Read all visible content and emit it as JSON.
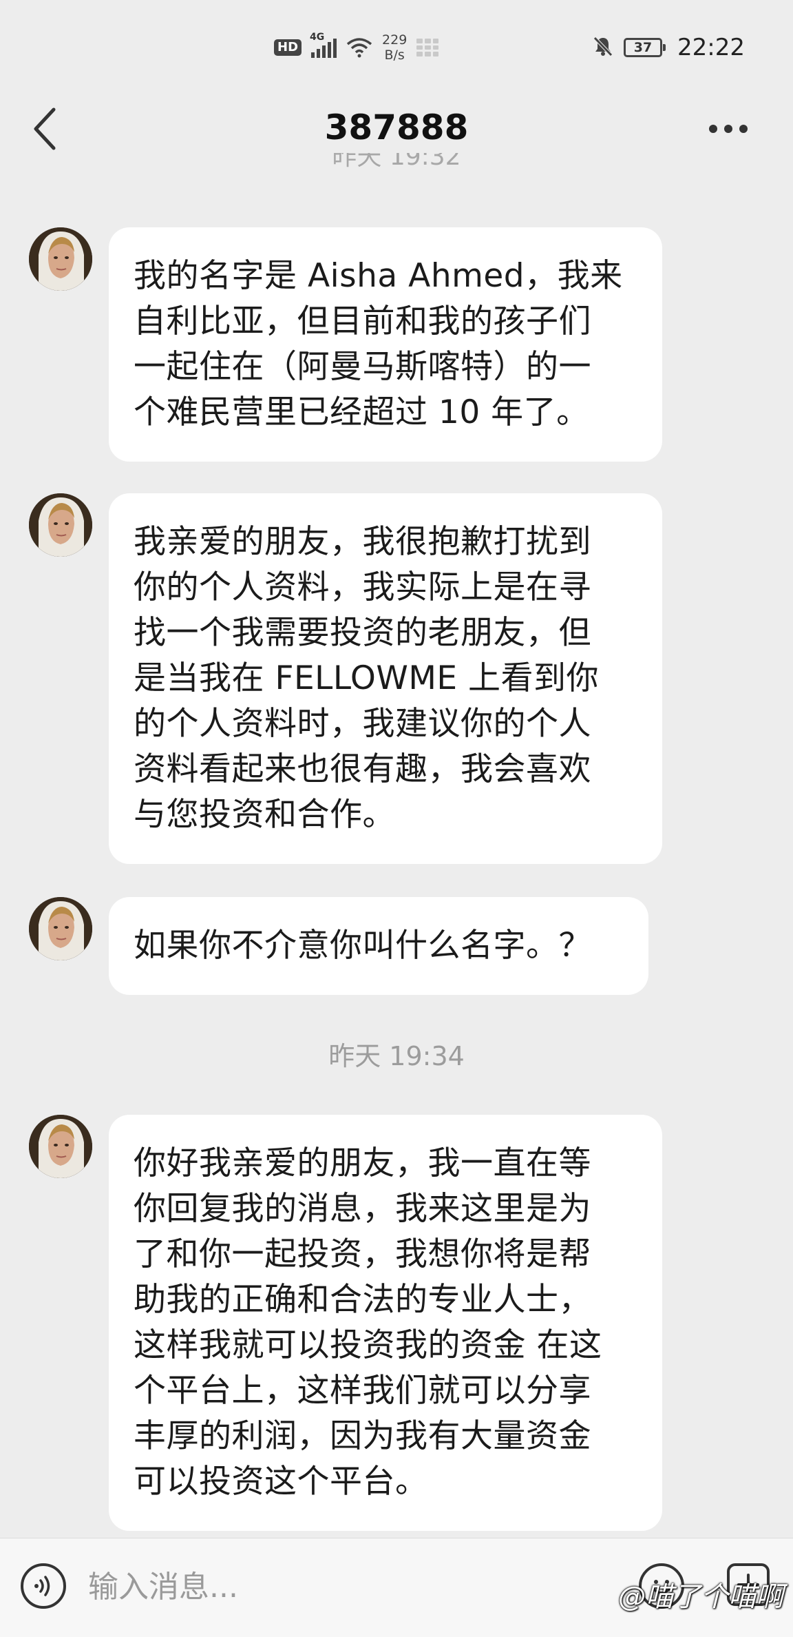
{
  "status_bar": {
    "hd": "HD",
    "network": "4G",
    "speed_value": "229",
    "speed_unit": "B/s",
    "battery": "37",
    "time": "22:22"
  },
  "header": {
    "title": "387888",
    "partial_timestamp": "昨天 19:32"
  },
  "messages": [
    {
      "sender": "other",
      "lines": [
        "我的名字是 Aisha Ahmed，我来",
        "自利比亚，但目前和我的孩子们",
        "一起住在（阿曼马斯喀特）的一",
        "个难民营里已经超过 10 年了。"
      ]
    },
    {
      "sender": "other",
      "lines": [
        "我亲爱的朋友，我很抱歉打扰到",
        "你的个人资料，我实际上是在寻",
        "找一个我需要投资的老朋友，但",
        "是当我在 FELLOWME 上看到你",
        "的个人资料时，我建议你的个人",
        "资料看起来也很有趣，我会喜欢",
        "与您投资和合作。"
      ]
    },
    {
      "sender": "other",
      "lines": [
        "如果你不介意你叫什么名字。？"
      ]
    },
    {
      "sender": "other",
      "lines": [
        "你好我亲爱的朋友，我一直在等",
        "你回复我的消息，我来这里是为",
        "了和你一起投资，我想你将是帮",
        "助我的正确和合法的专业人士，",
        "这样我就可以投资我的资金 在这",
        "个平台上，这样我们就可以分享",
        "丰厚的利润，因为我有大量资金",
        "可以投资这个平台。"
      ]
    }
  ],
  "time_separator": "昨天 19:34",
  "input": {
    "placeholder": "输入消息..."
  },
  "watermark": "@喵了个喵啊",
  "icons": {
    "back": "chevron-left-icon",
    "more": "more-dots-icon",
    "voice": "voice-icon",
    "emoji": "emoji-icon",
    "plus": "plus-icon"
  }
}
